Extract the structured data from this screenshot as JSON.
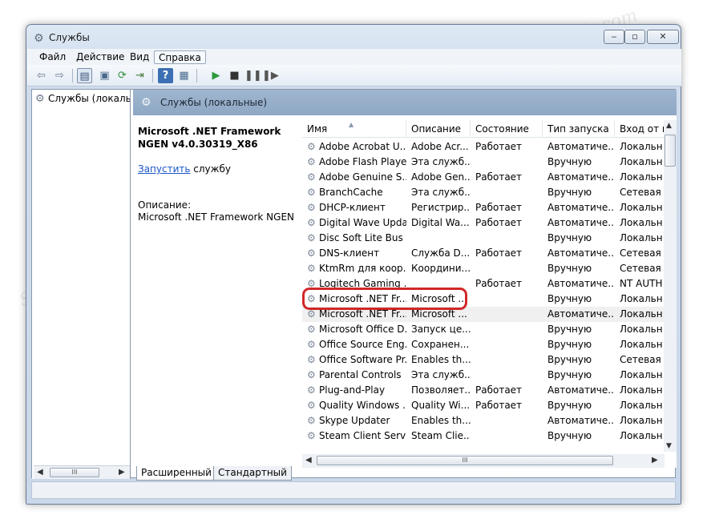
{
  "window": {
    "title": "Службы",
    "title_icon": "gear-icon",
    "buttons": {
      "minimize": "‒",
      "maximize": "▫",
      "close": "✕"
    }
  },
  "menu": [
    "Файл",
    "Действие",
    "Вид",
    "Справка"
  ],
  "toolbar": {
    "icons": [
      "back-arrow-icon",
      "forward-arrow-icon",
      "console-tree-icon",
      "properties-icon",
      "refresh-icon",
      "export-icon",
      "help-icon",
      "view-icon",
      "play-icon",
      "stop-icon",
      "pause-icon",
      "resume-icon"
    ]
  },
  "tree": {
    "item_label": "Службы (локалы",
    "scroll_thumb": "III"
  },
  "pane_header": {
    "title": "Службы (локальные)"
  },
  "description": {
    "service_name": "Microsoft .NET Framework NGEN v4.0.30319_X86",
    "start_link": "Запустить",
    "start_suffix": " службу",
    "label": "Описание:",
    "text": "Microsoft .NET Framework NGEN"
  },
  "list": {
    "columns": [
      "Имя",
      "Описание",
      "Состояние",
      "Тип запуска",
      "Вход от и"
    ],
    "rows": [
      [
        "Adobe Acrobat U...",
        "Adobe Acr...",
        "Работает",
        "Автоматиче...",
        "Локальн"
      ],
      [
        "Adobe Flash Playe...",
        "Эта служб...",
        "",
        "Вручную",
        "Локальн"
      ],
      [
        "Adobe Genuine S...",
        "Adobe Gen...",
        "Работает",
        "Автоматиче...",
        "Локальн"
      ],
      [
        "BranchCache",
        "Эта служб...",
        "",
        "Вручную",
        "Сетевая с"
      ],
      [
        "DHCP-клиент",
        "Регистрир...",
        "Работает",
        "Автоматиче...",
        "Локальн"
      ],
      [
        "Digital Wave Upda...",
        "Digital Wa...",
        "Работает",
        "Автоматиче...",
        "Локальн"
      ],
      [
        "Disc Soft Lite Bus ...",
        "",
        "",
        "Вручную",
        "Локальн"
      ],
      [
        "DNS-клиент",
        "Служба D...",
        "Работает",
        "Автоматиче...",
        "Сетевая с"
      ],
      [
        "KtmRm для коор...",
        "Координи...",
        "",
        "Вручную",
        "Сетевая с"
      ],
      [
        "Logitech Gaming ...",
        "",
        "Работает",
        "Автоматиче...",
        "NT AUTH"
      ],
      [
        "Microsoft .NET Fr...",
        "Microsoft ...",
        "",
        "Вручную",
        "Локальн"
      ],
      [
        "Microsoft .NET Fr...",
        "Microsoft ...",
        "",
        "Автоматиче...",
        "Локальн"
      ],
      [
        "Microsoft Office D...",
        "Запуск це...",
        "",
        "Вручную",
        "Локальн"
      ],
      [
        "Office  Source Eng...",
        "Сохранен...",
        "",
        "Вручную",
        "Локальн"
      ],
      [
        "Office Software Pr...",
        "Enables th...",
        "",
        "Вручную",
        "Сетевая с"
      ],
      [
        "Parental Controls",
        "Эта служб...",
        "",
        "Вручную",
        "Локальн"
      ],
      [
        "Plug-and-Play",
        "Позволяет...",
        "Работает",
        "Автоматиче...",
        "Локальн"
      ],
      [
        "Quality Windows ...",
        "Quality Wi...",
        "Работает",
        "Вручную",
        "Локальн"
      ],
      [
        "Skype Updater",
        "Enables th...",
        "",
        "Автоматиче...",
        "Локальн"
      ],
      [
        "Steam Client Servi...",
        "Steam Clie...",
        "",
        "Вручную",
        "Локальн"
      ]
    ],
    "highlighted_row": 10,
    "selected_row": 11,
    "scroll_thumb": "III"
  },
  "tabs": [
    "Расширенный",
    "Стандартный"
  ],
  "watermark": "Soringpcrepair.com",
  "colors": {
    "header": "#9fb6cf",
    "highlight": "#d12828",
    "link": "#1a55c8"
  }
}
